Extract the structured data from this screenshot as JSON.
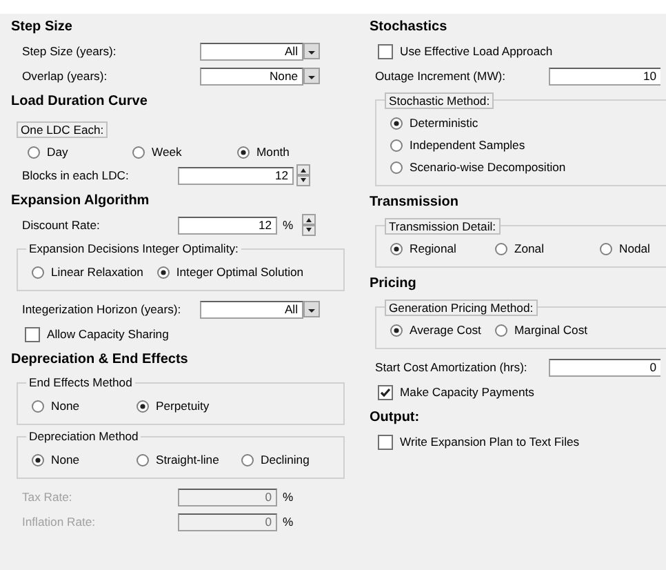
{
  "columns": [
    {
      "sections": [
        {
          "heading": "Step Size",
          "items": [
            {
              "kind": "combo",
              "label": "Step Size (years):",
              "value": "All"
            },
            {
              "kind": "combo",
              "label": "Overlap (years):",
              "value": "None"
            }
          ]
        },
        {
          "heading": "Load Duration Curve",
          "items": [
            {
              "kind": "radio-group",
              "title": "One LDC Each:",
              "framed": false,
              "options": [
                {
                  "label": "Day",
                  "selected": false
                },
                {
                  "label": "Week",
                  "selected": false
                },
                {
                  "label": "Month",
                  "selected": true
                }
              ]
            },
            {
              "kind": "spin",
              "label": "Blocks in each LDC:",
              "value": "12"
            }
          ]
        },
        {
          "heading": "Expansion Algorithm",
          "items": [
            {
              "kind": "spin",
              "label": "Discount Rate:",
              "value": "12",
              "unit": "%"
            },
            {
              "kind": "radio-group",
              "title": "Expansion Decisions Integer Optimality:",
              "framed": true,
              "boxed_title": false,
              "options": [
                {
                  "label": "Linear Relaxation",
                  "selected": false
                },
                {
                  "label": "Integer Optimal Solution",
                  "selected": true
                }
              ]
            },
            {
              "kind": "combo",
              "label": "Integerization Horizon (years):",
              "value": "All"
            },
            {
              "kind": "checkbox",
              "label": "Allow Capacity Sharing",
              "checked": false
            }
          ]
        },
        {
          "heading": "Depreciation & End Effects",
          "items": [
            {
              "kind": "radio-group",
              "title": "End Effects Method",
              "framed": true,
              "boxed_title": false,
              "options": [
                {
                  "label": "None",
                  "selected": false
                },
                {
                  "label": "Perpetuity",
                  "selected": true
                }
              ]
            },
            {
              "kind": "radio-group",
              "title": "Depreciation Method",
              "framed": true,
              "boxed_title": false,
              "options": [
                {
                  "label": "None",
                  "selected": true
                },
                {
                  "label": "Straight-line",
                  "selected": false
                },
                {
                  "label": "Declining",
                  "selected": false
                }
              ]
            },
            {
              "kind": "field",
              "label": "Tax Rate:",
              "value": "0",
              "unit": "%",
              "disabled": true
            },
            {
              "kind": "field",
              "label": "Inflation Rate:",
              "value": "0",
              "unit": "%",
              "disabled": true
            }
          ]
        }
      ]
    },
    {
      "sections": [
        {
          "heading": "Stochastics",
          "items": [
            {
              "kind": "checkbox",
              "label": "Use Effective Load Approach",
              "checked": false
            },
            {
              "kind": "field",
              "label": "Outage Increment (MW):",
              "value": "10",
              "disabled": false
            },
            {
              "kind": "radio-list",
              "title": "Stochastic Method:",
              "framed": true,
              "boxed_title": true,
              "options": [
                {
                  "label": "Deterministic",
                  "selected": true
                },
                {
                  "label": "Independent Samples",
                  "selected": false
                },
                {
                  "label": "Scenario-wise Decomposition",
                  "selected": false
                }
              ]
            }
          ]
        },
        {
          "heading": "Transmission",
          "items": [
            {
              "kind": "radio-group",
              "title": "Transmission Detail:",
              "framed": true,
              "boxed_title": true,
              "options": [
                {
                  "label": "Regional",
                  "selected": true
                },
                {
                  "label": "Zonal",
                  "selected": false
                },
                {
                  "label": "Nodal",
                  "selected": false
                }
              ]
            }
          ]
        },
        {
          "heading": "Pricing",
          "items": [
            {
              "kind": "radio-group",
              "title": "Generation Pricing Method:",
              "framed": true,
              "boxed_title": true,
              "options": [
                {
                  "label": "Average Cost",
                  "selected": true
                },
                {
                  "label": "Marginal Cost",
                  "selected": false
                }
              ]
            },
            {
              "kind": "field",
              "label": "Start Cost Amortization (hrs):",
              "value": "0",
              "disabled": false
            },
            {
              "kind": "checkbox",
              "label": "Make Capacity Payments",
              "checked": true
            }
          ]
        },
        {
          "heading": "Output:",
          "items": [
            {
              "kind": "checkbox",
              "label": "Write Expansion Plan to Text Files",
              "checked": false
            }
          ]
        }
      ]
    }
  ]
}
